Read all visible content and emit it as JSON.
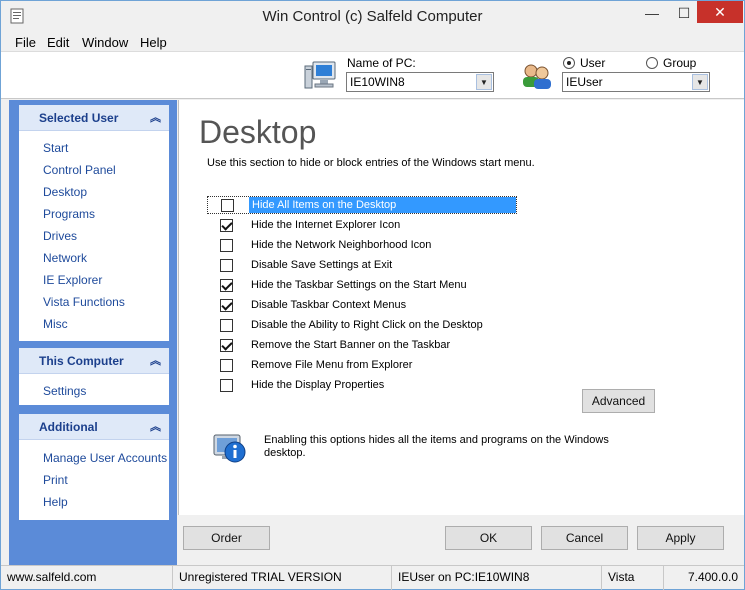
{
  "window": {
    "title": "Win Control (c) Salfeld Computer",
    "minimize": "—",
    "maximize": "☐",
    "close": "✕"
  },
  "menu": [
    "File",
    "Edit",
    "Window",
    "Help"
  ],
  "topbar": {
    "pc_label": "Name of PC:",
    "pc_value": "IE10WIN8",
    "radio_user": "User",
    "radio_group": "Group",
    "selected_radio": "User",
    "user_value": "IEUser"
  },
  "sidebar": {
    "selected_user": {
      "title": "Selected User",
      "items": [
        "Start",
        "Control Panel",
        "Desktop",
        "Programs",
        "Drives",
        "Network",
        "IE Explorer",
        "Vista Functions",
        "Misc"
      ]
    },
    "this_computer": {
      "title": "This Computer",
      "items": [
        "Settings"
      ]
    },
    "additional": {
      "title": "Additional",
      "items": [
        "Manage User Accounts",
        "Print",
        "Help"
      ]
    },
    "collapse_glyph": "︽"
  },
  "content": {
    "title": "Desktop",
    "description": "Use this section to hide or block entries of the Windows start menu.",
    "options": [
      {
        "label": "Hide All Items on the Desktop",
        "checked": false,
        "focused": true
      },
      {
        "label": "Hide the Internet Explorer Icon",
        "checked": true
      },
      {
        "label": "Hide the Network Neighborhood Icon",
        "checked": false
      },
      {
        "label": "Disable Save Settings at Exit",
        "checked": false
      },
      {
        "label": "Hide the Taskbar Settings on the Start Menu",
        "checked": true
      },
      {
        "label": "Disable Taskbar Context Menus",
        "checked": true
      },
      {
        "label": "Disable the Ability to Right Click on the Desktop",
        "checked": false
      },
      {
        "label": "Remove the Start Banner on the Taskbar",
        "checked": true
      },
      {
        "label": "Remove File Menu from Explorer",
        "checked": false
      },
      {
        "label": "Hide the Display Properties",
        "checked": false
      }
    ],
    "advanced_label": "Advanced",
    "info_text": "Enabling this options hides all the items and programs on the Windows desktop."
  },
  "buttons": {
    "order": "Order",
    "ok": "OK",
    "cancel": "Cancel",
    "apply": "Apply"
  },
  "status": {
    "website": "www.salfeld.com",
    "license": "Unregistered TRIAL VERSION",
    "user_pc": "IEUser on PC:IE10WIN8",
    "os": "Vista",
    "version": "7.400.0.0"
  },
  "colors": {
    "sidebar_bg": "#5b8bd8",
    "panel_header": "#dfe9f8",
    "link": "#1e4a9b",
    "selection": "#3399ff",
    "close_button": "#c7312a"
  }
}
